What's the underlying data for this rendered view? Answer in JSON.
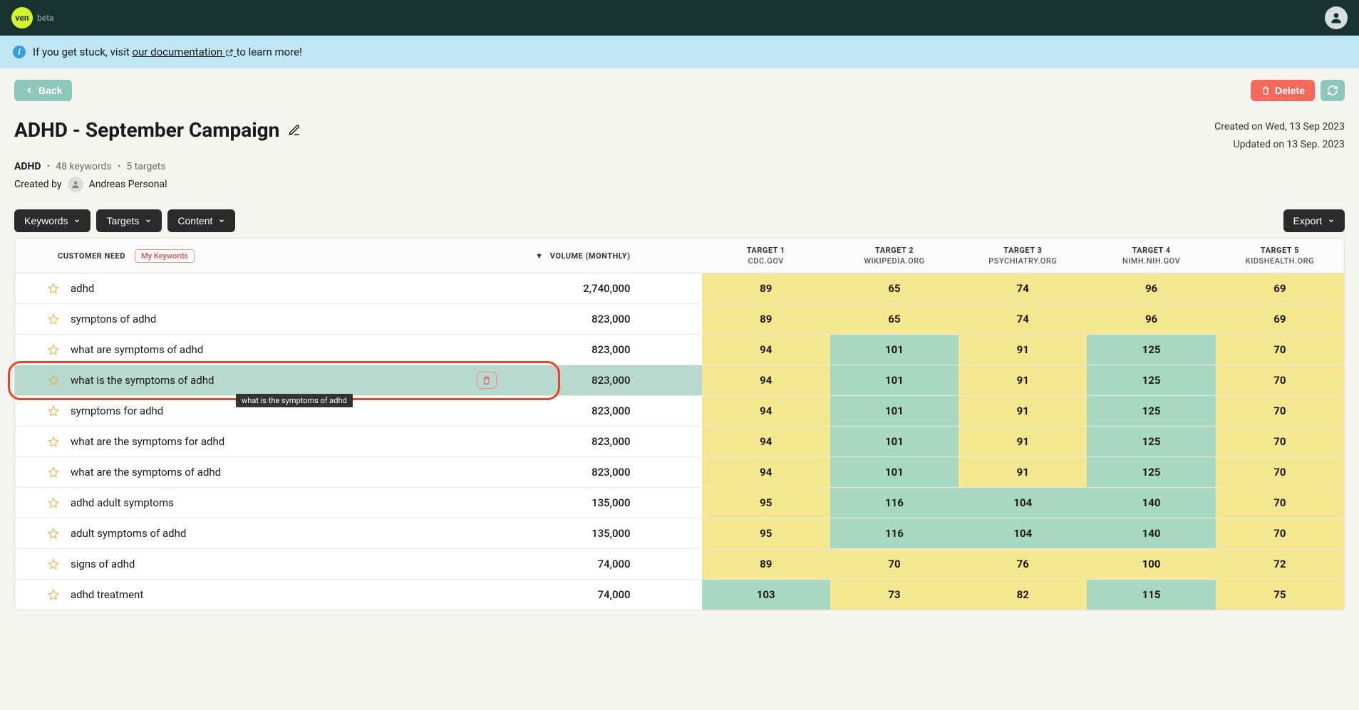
{
  "logo": {
    "text": "ven",
    "beta": "beta"
  },
  "banner": {
    "prefix": "If you get stuck, visit ",
    "link": "our documentation",
    "suffix": " to learn more!"
  },
  "toolbar": {
    "back": "Back",
    "delete": "Delete"
  },
  "page": {
    "title": "ADHD - September Campaign",
    "created": "Created on Wed, 13 Sep 2023",
    "updated": "Updated on 13 Sep. 2023",
    "topic": "ADHD",
    "keywords": "48 keywords",
    "targets": "5 targets",
    "created_by_label": "Created by",
    "created_by_name": "Andreas Personal"
  },
  "dropdowns": {
    "keywords": "Keywords",
    "targets": "Targets",
    "content": "Content",
    "export": "Export"
  },
  "table": {
    "headers": {
      "need": "CUSTOMER NEED",
      "my_keywords": "My Keywords",
      "volume": "VOLUME (MONTHLY)",
      "targets": [
        {
          "label": "TARGET 1",
          "domain": "CDC.GOV"
        },
        {
          "label": "TARGET 2",
          "domain": "WIKIPEDIA.ORG"
        },
        {
          "label": "TARGET 3",
          "domain": "PSYCHIATRY.ORG"
        },
        {
          "label": "TARGET 4",
          "domain": "NIMH.NIH.GOV"
        },
        {
          "label": "TARGET 5",
          "domain": "KIDSHEALTH.ORG"
        }
      ]
    },
    "rows": [
      {
        "need": "adhd",
        "volume": "2,740,000",
        "t": [
          {
            "v": "89",
            "c": "y"
          },
          {
            "v": "65",
            "c": "y"
          },
          {
            "v": "74",
            "c": "y"
          },
          {
            "v": "96",
            "c": "y"
          },
          {
            "v": "69",
            "c": "y"
          }
        ]
      },
      {
        "need": "symptons of adhd",
        "volume": "823,000",
        "t": [
          {
            "v": "89",
            "c": "y"
          },
          {
            "v": "65",
            "c": "y"
          },
          {
            "v": "74",
            "c": "y"
          },
          {
            "v": "96",
            "c": "y"
          },
          {
            "v": "69",
            "c": "y"
          }
        ]
      },
      {
        "need": "what are symptoms of adhd",
        "volume": "823,000",
        "t": [
          {
            "v": "94",
            "c": "y"
          },
          {
            "v": "101",
            "c": "g"
          },
          {
            "v": "91",
            "c": "y"
          },
          {
            "v": "125",
            "c": "g"
          },
          {
            "v": "70",
            "c": "y"
          }
        ]
      },
      {
        "need": "what is the symptoms of adhd",
        "volume": "823,000",
        "highlighted": true,
        "trash": true,
        "t": [
          {
            "v": "94",
            "c": "y"
          },
          {
            "v": "101",
            "c": "g"
          },
          {
            "v": "91",
            "c": "y"
          },
          {
            "v": "125",
            "c": "g"
          },
          {
            "v": "70",
            "c": "y"
          }
        ]
      },
      {
        "need": "symptoms for adhd",
        "volume": "823,000",
        "t": [
          {
            "v": "94",
            "c": "y"
          },
          {
            "v": "101",
            "c": "g"
          },
          {
            "v": "91",
            "c": "y"
          },
          {
            "v": "125",
            "c": "g"
          },
          {
            "v": "70",
            "c": "y"
          }
        ]
      },
      {
        "need": "what are the symptoms for adhd",
        "volume": "823,000",
        "t": [
          {
            "v": "94",
            "c": "y"
          },
          {
            "v": "101",
            "c": "g"
          },
          {
            "v": "91",
            "c": "y"
          },
          {
            "v": "125",
            "c": "g"
          },
          {
            "v": "70",
            "c": "y"
          }
        ]
      },
      {
        "need": "what are the symptoms of adhd",
        "volume": "823,000",
        "t": [
          {
            "v": "94",
            "c": "y"
          },
          {
            "v": "101",
            "c": "g"
          },
          {
            "v": "91",
            "c": "y"
          },
          {
            "v": "125",
            "c": "g"
          },
          {
            "v": "70",
            "c": "y"
          }
        ]
      },
      {
        "need": "adhd adult symptoms",
        "volume": "135,000",
        "t": [
          {
            "v": "95",
            "c": "y"
          },
          {
            "v": "116",
            "c": "g"
          },
          {
            "v": "104",
            "c": "g"
          },
          {
            "v": "140",
            "c": "g"
          },
          {
            "v": "70",
            "c": "y"
          }
        ]
      },
      {
        "need": "adult symptoms of adhd",
        "volume": "135,000",
        "t": [
          {
            "v": "95",
            "c": "y"
          },
          {
            "v": "116",
            "c": "g"
          },
          {
            "v": "104",
            "c": "g"
          },
          {
            "v": "140",
            "c": "g"
          },
          {
            "v": "70",
            "c": "y"
          }
        ]
      },
      {
        "need": "signs of adhd",
        "volume": "74,000",
        "t": [
          {
            "v": "89",
            "c": "y"
          },
          {
            "v": "70",
            "c": "y"
          },
          {
            "v": "76",
            "c": "y"
          },
          {
            "v": "100",
            "c": "y"
          },
          {
            "v": "72",
            "c": "y"
          }
        ]
      },
      {
        "need": "adhd treatment",
        "volume": "74,000",
        "t": [
          {
            "v": "103",
            "c": "g"
          },
          {
            "v": "73",
            "c": "y"
          },
          {
            "v": "82",
            "c": "y"
          },
          {
            "v": "115",
            "c": "g"
          },
          {
            "v": "75",
            "c": "y"
          }
        ]
      }
    ]
  },
  "tooltip_row3": "what is the symptoms of adhd"
}
